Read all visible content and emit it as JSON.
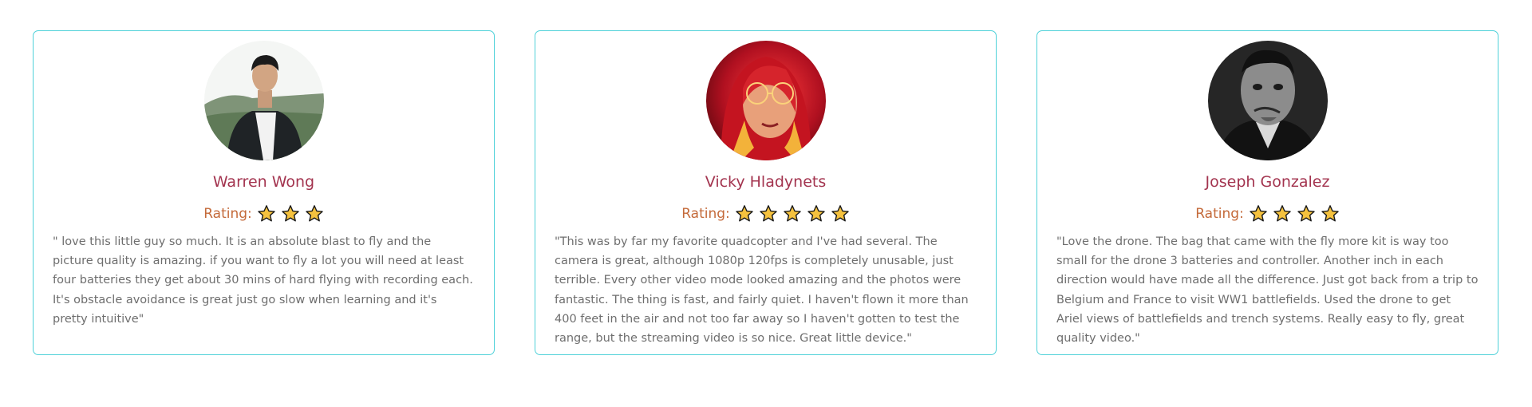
{
  "rating_label": "Rating:",
  "colors": {
    "card_border": "#4fd1d9",
    "name": "#a3344f",
    "rating_label": "#c46a3a",
    "star_fill": "#f5c23e",
    "review_text": "#6e6e6e"
  },
  "reviews": [
    {
      "name": "Warren Wong",
      "stars": 3,
      "avatar_icon": "person-portrait",
      "text": "\" love this little guy so much. It is an absolute blast to fly and the picture quality is amazing. if you want to fly a lot you will need at least four batteries they get about 30 mins of hard flying with recording each. It's obstacle avoidance is great just go slow when learning and it's pretty intuitive\""
    },
    {
      "name": "Vicky Hladynets",
      "stars": 5,
      "avatar_icon": "person-portrait",
      "text": "\"This was by far my favorite quadcopter and I've had several. The camera is great, although 1080p 120fps is completely unusable, just terrible. Every other video mode looked amazing and the photos were fantastic. The thing is fast, and fairly quiet. I haven't flown it more than 400 feet in the air and not too far away so I haven't gotten to test the range, but the streaming video is so nice. Great little device.\""
    },
    {
      "name": "Joseph Gonzalez",
      "stars": 4,
      "avatar_icon": "person-portrait",
      "text": "\"Love the drone. The bag that came with the fly more kit is way too small for the drone 3 batteries and controller. Another inch in each direction would have made all the difference. Just got back from a trip to Belgium and France to visit WW1 battlefields. Used the drone to get Ariel views of battlefields and trench systems. Really easy to fly, great quality video.\""
    }
  ]
}
